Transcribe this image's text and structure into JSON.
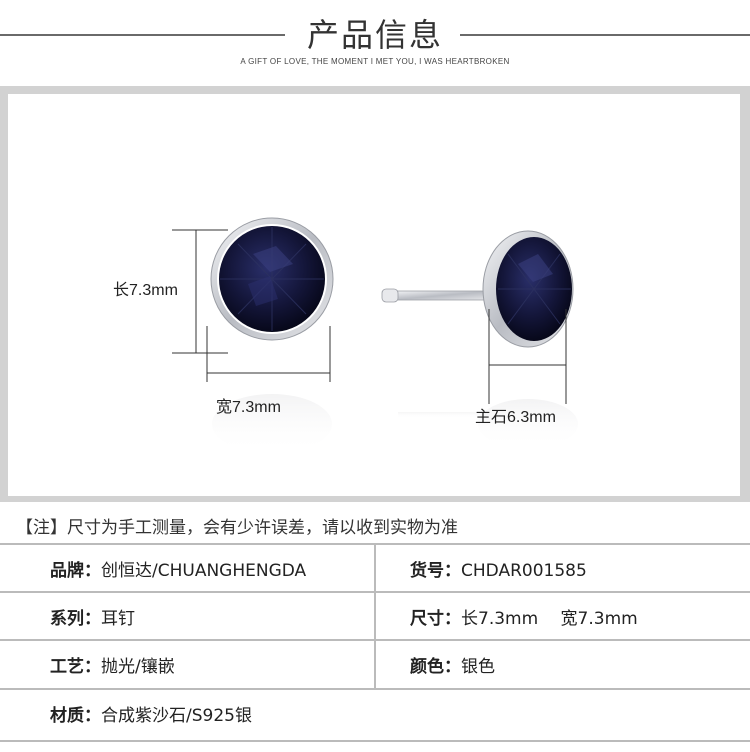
{
  "header": {
    "title": "产品信息",
    "subtitle": "A GIFT OF LOVE, THE MOMENT I MET YOU, I WAS HEARTBROKEN"
  },
  "product_image": {
    "length_label": "长7.3mm",
    "width_label": "宽7.3mm",
    "stone_label": "主石6.3mm",
    "stone_color": "#14163a",
    "metal_color": "#c9ccd2"
  },
  "note": "【注】尺寸为手工测量，会有少许误差，请以收到实物为准",
  "specs": {
    "row1": {
      "left_key": "品牌：",
      "left_val": "创恒达/CHUANGHENGDA",
      "right_key": "货号：",
      "right_val": "CHDAR001585"
    },
    "row2": {
      "left_key": "系列：",
      "left_val": "耳钉",
      "right_key": "尺寸：",
      "right_val": "长7.3mm　 宽7.3mm"
    },
    "row3": {
      "left_key": "工艺：",
      "left_val": "抛光/镶嵌",
      "right_key": "颜色：",
      "right_val": "银色"
    },
    "row4": {
      "left_key": "材质：",
      "left_val": "合成紫沙石/S925银"
    }
  }
}
